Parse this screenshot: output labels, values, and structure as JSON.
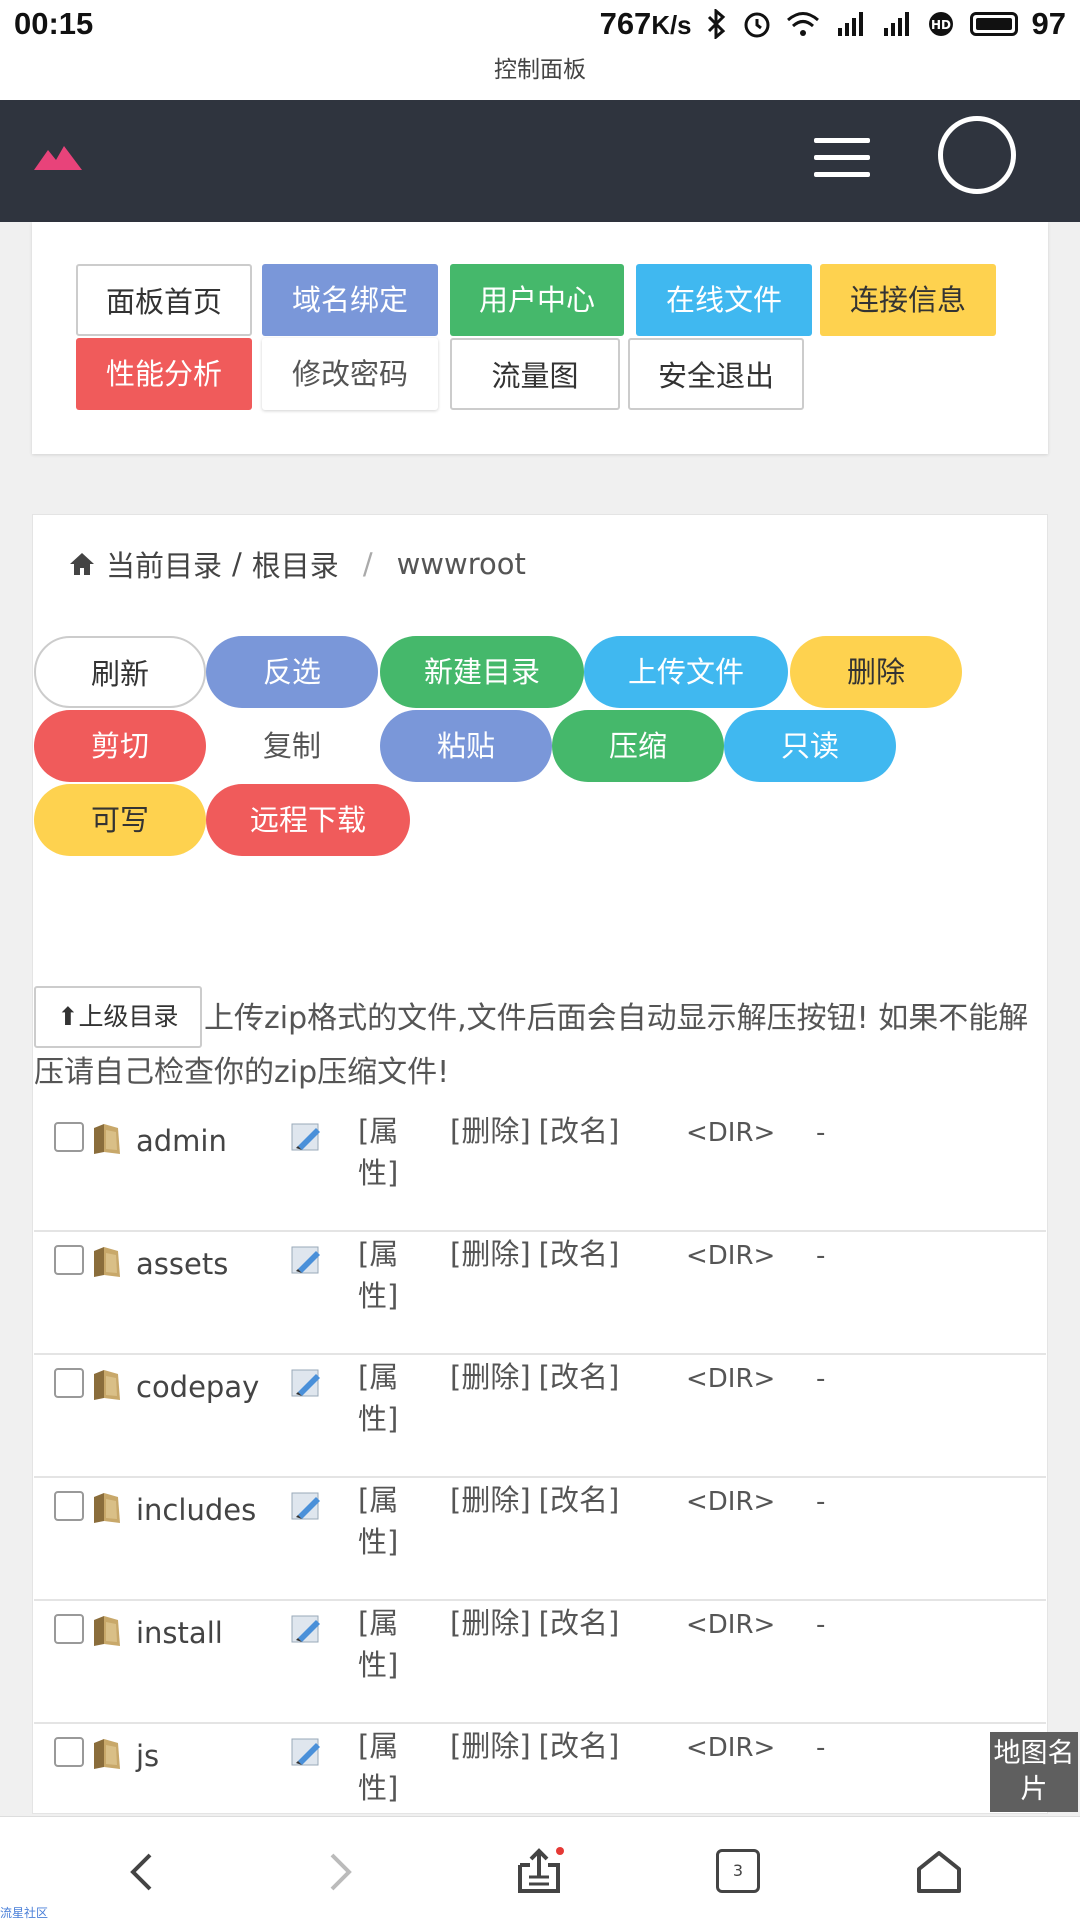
{
  "status_bar": {
    "time": "00:15",
    "speed": "767",
    "speed_unit": "K/s",
    "battery": "97",
    "icons": [
      "bluetooth-icon",
      "alarm-icon",
      "wifi-icon",
      "signal-3g-icon",
      "signal-4g-icon",
      "hd-icon",
      "battery-icon"
    ]
  },
  "window": {
    "title": "控制面板"
  },
  "header": {
    "logo": "logo-icon",
    "menu": "hamburger-menu-icon",
    "avatar": "avatar-circle"
  },
  "nav_buttons": [
    {
      "label": "面板首页",
      "style": "outline"
    },
    {
      "label": "域名绑定",
      "color": "#7a97d9"
    },
    {
      "label": "用户中心",
      "color": "#45b86b"
    },
    {
      "label": "在线文件",
      "color": "#40b8f0"
    },
    {
      "label": "连接信息",
      "color": "#fed24f"
    },
    {
      "label": "性能分析",
      "color": "#f05b5b"
    },
    {
      "label": "修改密码",
      "style": "plain"
    },
    {
      "label": "流量图",
      "style": "outline"
    },
    {
      "label": "安全退出",
      "style": "outline"
    }
  ],
  "breadcrumb": {
    "home_icon": "home-icon",
    "current_label": "当前目录",
    "root": "根目录",
    "folder": "wwwroot"
  },
  "action_buttons": [
    {
      "label": "刷新",
      "style": "outline"
    },
    {
      "label": "反选",
      "color": "#7a97d9"
    },
    {
      "label": "新建目录",
      "color": "#45b86b"
    },
    {
      "label": "上传文件",
      "color": "#40b8f0"
    },
    {
      "label": "删除",
      "color": "#fed24f"
    },
    {
      "label": "剪切",
      "color": "#f05b5b"
    },
    {
      "label": "复制",
      "style": "plain"
    },
    {
      "label": "粘贴",
      "color": "#7a97d9"
    },
    {
      "label": "压缩",
      "color": "#45b86b"
    },
    {
      "label": "只读",
      "color": "#40b8f0"
    },
    {
      "label": "可写",
      "color": "#fed24f"
    },
    {
      "label": "远程下载",
      "color": "#f05b5b"
    }
  ],
  "up_button": "⬆上级目录",
  "notice": "上传zip格式的文件,文件后面会自动显示解压按钮! 如果不能解压请自己检查你的zip压缩文件!",
  "files": [
    {
      "name": "admin",
      "attr": "[属性]",
      "delete": "[删除]",
      "rename": "[改名]",
      "type": "<DIR>",
      "size": "-"
    },
    {
      "name": "assets",
      "attr": "[属性]",
      "delete": "[删除]",
      "rename": "[改名]",
      "type": "<DIR>",
      "size": "-"
    },
    {
      "name": "codepay",
      "attr": "[属性]",
      "delete": "[删除]",
      "rename": "[改名]",
      "type": "<DIR>",
      "size": "-"
    },
    {
      "name": "includes",
      "attr": "[属性]",
      "delete": "[删除]",
      "rename": "[改名]",
      "type": "<DIR>",
      "size": "-"
    },
    {
      "name": "install",
      "attr": "[属性]",
      "delete": "[删除]",
      "rename": "[改名]",
      "type": "<DIR>",
      "size": "-"
    },
    {
      "name": "js",
      "attr": "[属性]",
      "delete": "[删除]",
      "rename": "[改名]",
      "type": "<DIR>",
      "size": "-"
    }
  ],
  "map_card": "地图名片",
  "bottom_nav": {
    "tab_count": "3",
    "icons": [
      "back-icon",
      "forward-icon",
      "share-icon",
      "tabs-icon",
      "home-nav-icon"
    ]
  },
  "watermark": "流星社区"
}
